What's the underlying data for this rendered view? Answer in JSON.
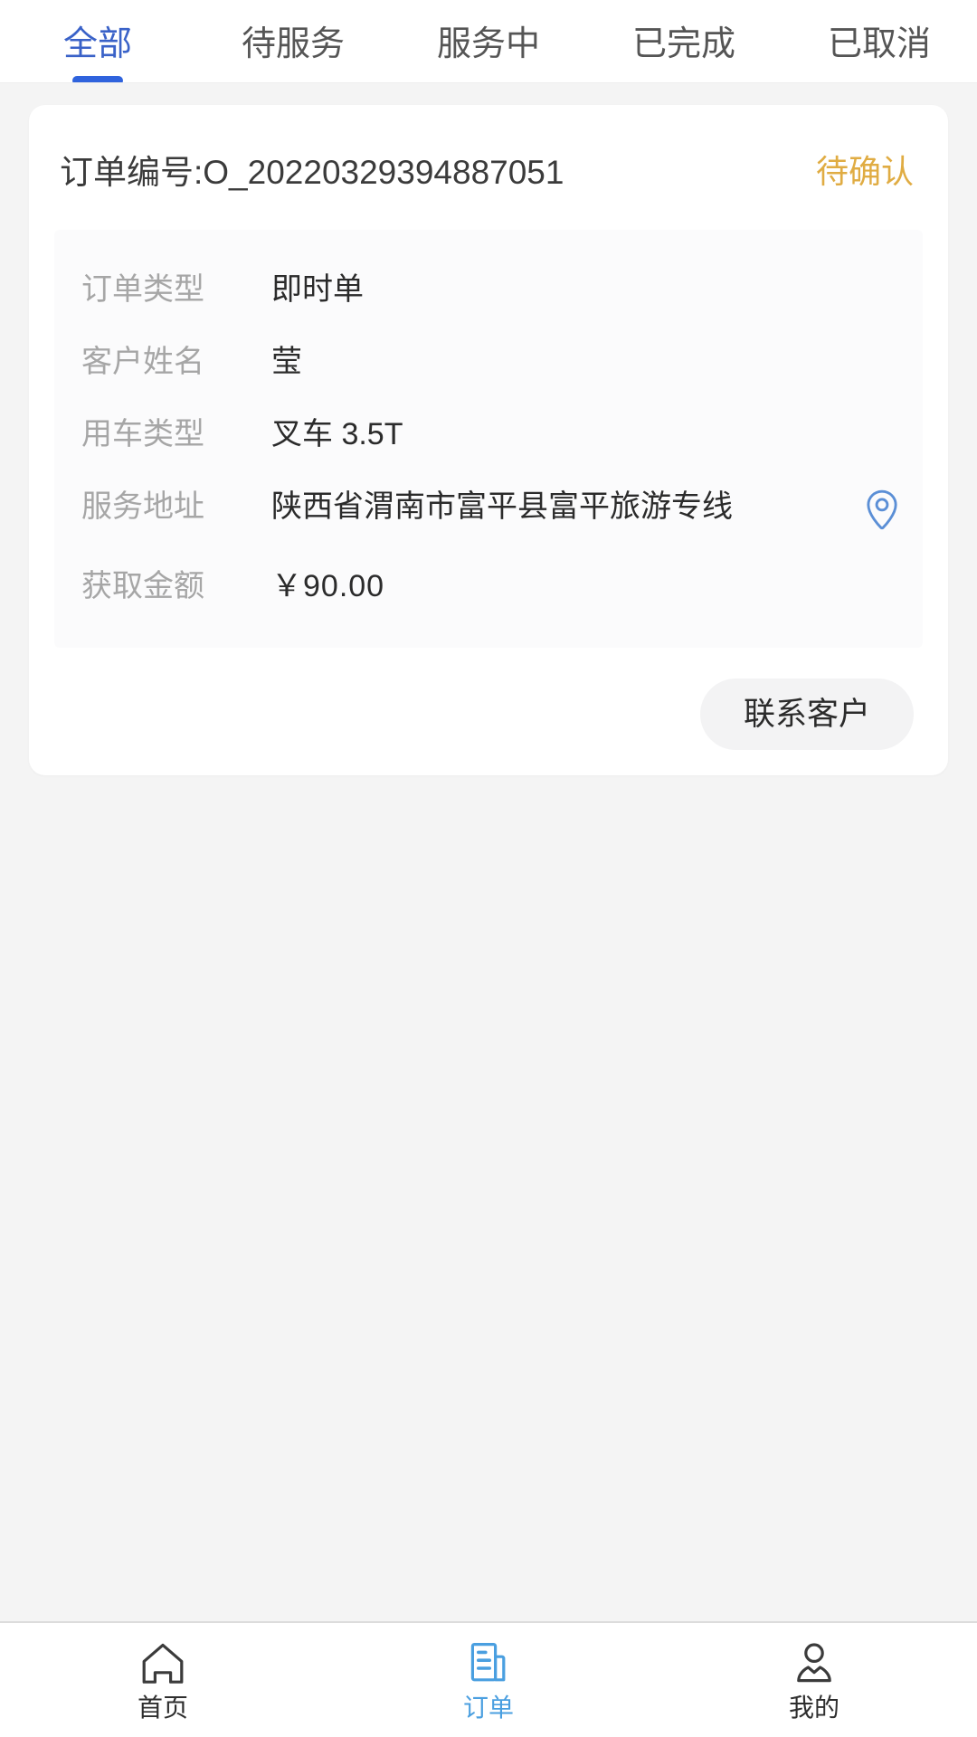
{
  "tabs": [
    {
      "label": "全部",
      "active": true
    },
    {
      "label": "待服务",
      "active": false
    },
    {
      "label": "服务中",
      "active": false
    },
    {
      "label": "已完成",
      "active": false
    },
    {
      "label": "已取消",
      "active": false
    }
  ],
  "order": {
    "order_no": "订单编号:O_20220329394887051",
    "status": "待确认",
    "status_color": "#e0ac43",
    "rows": [
      {
        "label": "订单类型",
        "value": "即时单",
        "icon": null
      },
      {
        "label": "客户姓名",
        "value": "莹",
        "icon": null
      },
      {
        "label": "用车类型",
        "value": "叉车 3.5T",
        "icon": null
      },
      {
        "label": "服务地址",
        "value": "陕西省渭南市富平县富平旅游专线",
        "icon": "location-pin-icon"
      },
      {
        "label": "获取金额",
        "value": "￥90.00",
        "icon": null
      }
    ],
    "contact_button": "联系客户"
  },
  "bottom_nav": [
    {
      "label": "首页",
      "icon": "home-icon",
      "active": false
    },
    {
      "label": "订单",
      "icon": "document-icon",
      "active": true
    },
    {
      "label": "我的",
      "icon": "person-icon",
      "active": false
    }
  ],
  "colors": {
    "accent_blue": "#2f63dd",
    "tab_active": "#3a62c8",
    "nav_active": "#4a9fe0",
    "page_bg": "#f4f4f4"
  }
}
